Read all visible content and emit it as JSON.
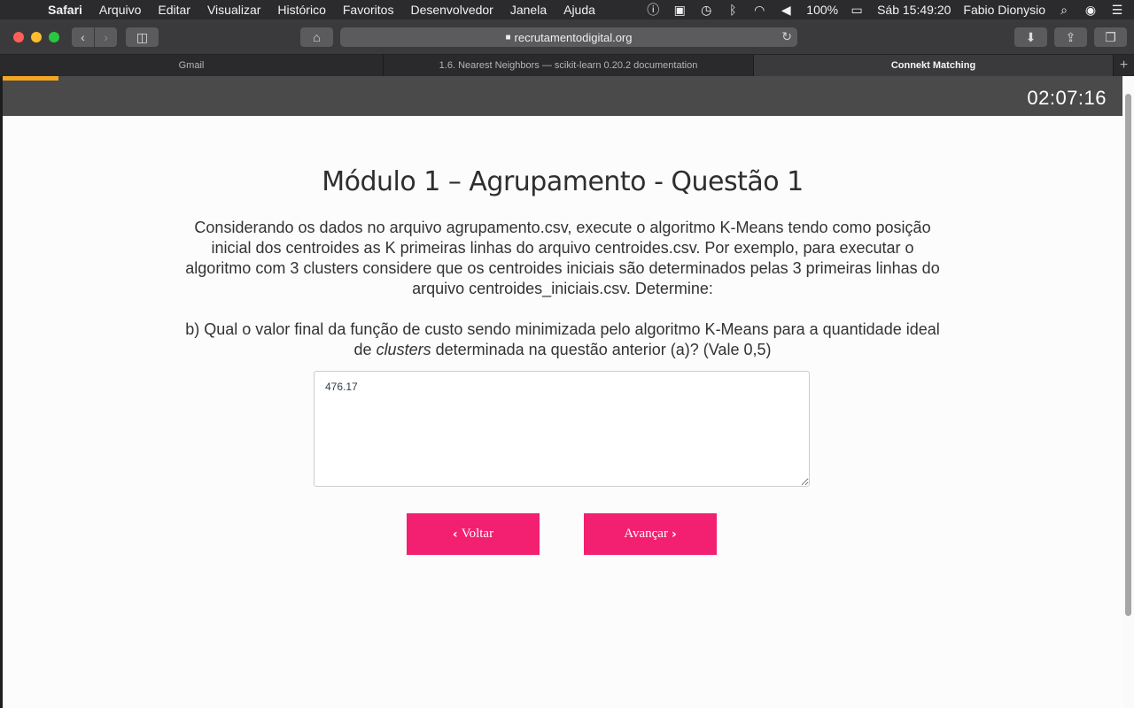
{
  "menubar": {
    "apple_icon": "apple-logo",
    "app": "Safari",
    "items": [
      "Arquivo",
      "Editar",
      "Visualizar",
      "Histórico",
      "Favoritos",
      "Desenvolvedor",
      "Janela",
      "Ajuda"
    ],
    "battery": "100%",
    "datetime": "Sáb 15:49:20",
    "user": "Fabio Dionysio"
  },
  "toolbar": {
    "url": "recrutamentodigital.org"
  },
  "tabs": [
    {
      "label": "Gmail",
      "active": false
    },
    {
      "label": "1.6. Nearest Neighbors — scikit-learn 0.20.2 documentation",
      "active": false
    },
    {
      "label": "Connekt Matching",
      "active": true
    }
  ],
  "page": {
    "progress": 0.05,
    "timer": "02:07:16",
    "title": "Módulo 1 – Agrupamento - Questão 1",
    "question": "Considerando os dados no arquivo agrupamento.csv, execute o algoritmo K-Means tendo como posição inicial dos centroides as K primeiras linhas do arquivo centroides.csv. Por exemplo, para executar o algoritmo com 3 clusters considere que os centroides iniciais são determinados pelas 3 primeiras linhas do arquivo centroides_iniciais.csv. Determine:",
    "sub_before": "b) Qual o valor final da função de custo sendo minimizada pelo algoritmo K-Means para a quantidade ideal de ",
    "sub_em": "clusters",
    "sub_after": " determinada na questão anterior (a)? (Vale 0,5)",
    "answer": "476.17",
    "back_label": "Voltar",
    "next_label": "Avançar"
  },
  "colors": {
    "accent": "#f31f71",
    "progress": "#f5a623",
    "header": "#4a4a4a"
  }
}
